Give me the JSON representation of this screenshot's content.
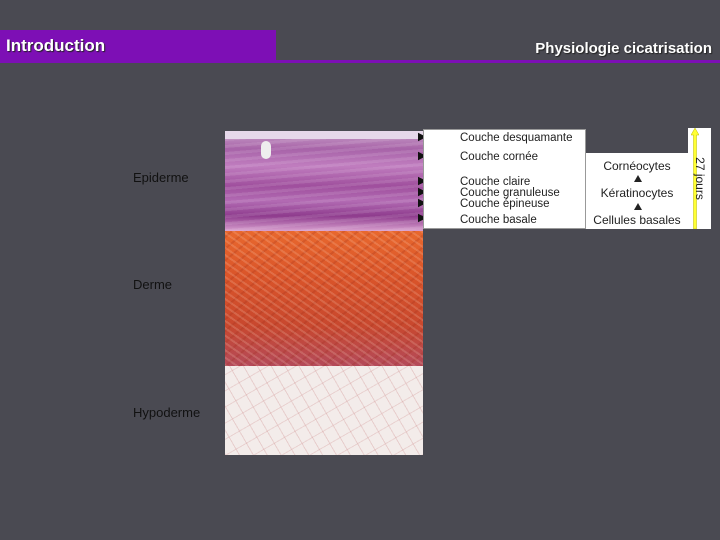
{
  "header": {
    "section_title": "Introduction",
    "subtitle": "Physiologie cicatrisation"
  },
  "layers": {
    "epiderme": "Epiderme",
    "derme": "Derme",
    "hypoderme": "Hypoderme"
  },
  "epidermis_sublayers": [
    "Couche desquamante",
    "Couche cornée",
    "Couche claire",
    "Couche granuleuse",
    "Couche épineuse",
    "Couche basale"
  ],
  "cells": [
    "Cornéocytes",
    "Kératinocytes",
    "Cellules basales"
  ],
  "duration": "27 jours",
  "colors": {
    "accent": "#7d0fb5",
    "background": "#4a4a52",
    "time_arrow": "#ffff33"
  }
}
